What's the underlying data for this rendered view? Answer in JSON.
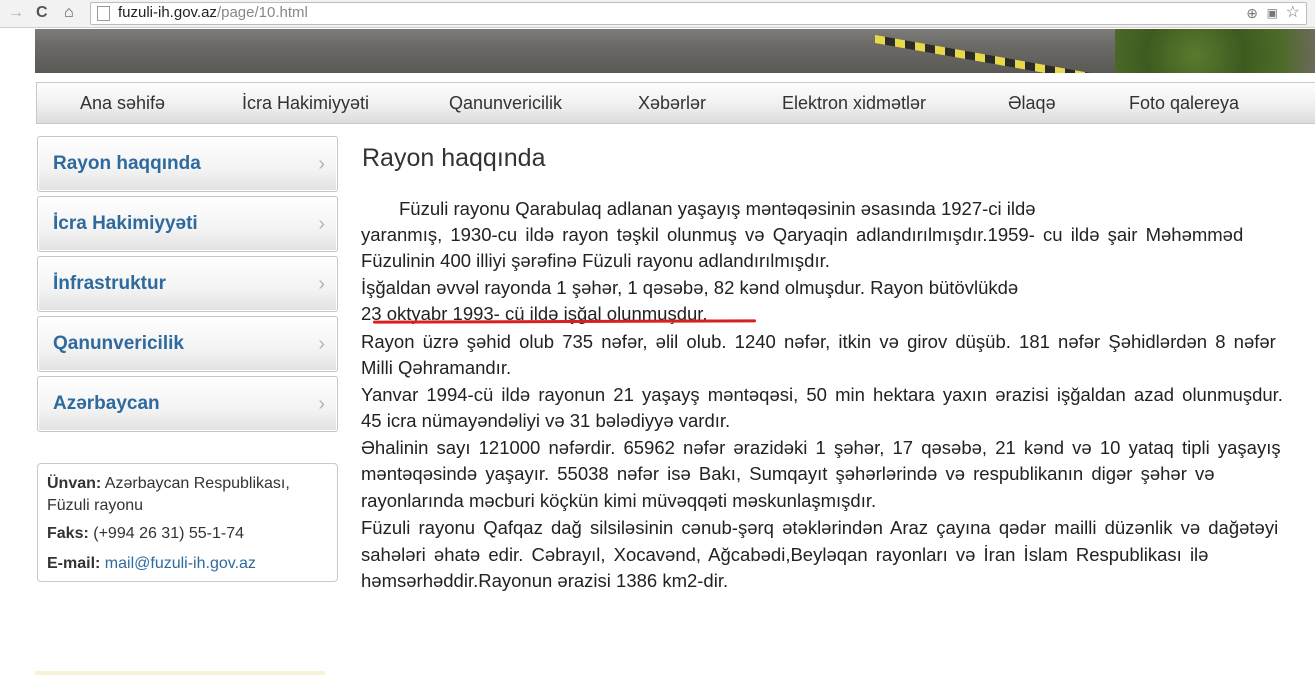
{
  "browser": {
    "url_host": "fuzuli-ih.gov.az",
    "url_path": "/page/10.html"
  },
  "menu": {
    "items": [
      "Ana səhifə",
      "İcra Hakimiyyəti",
      "Qanunvericilik",
      "Xəbərlər",
      "Elektron xidmətlər",
      "Əlaqə",
      "Foto qalereya"
    ]
  },
  "sidebar": {
    "items": [
      {
        "label": "Rayon haqqında"
      },
      {
        "label": "İcra Hakimiyyəti"
      },
      {
        "label": "İnfrastruktur"
      },
      {
        "label": "Qanunvericilik"
      },
      {
        "label": "Azərbaycan"
      }
    ]
  },
  "contact": {
    "address_label": "Ünvan:",
    "address_line1": "Azərbaycan Respublikası,",
    "address_line2": "Füzuli rayonu",
    "fax_label": "Faks:",
    "fax_value": "(+994 26 31) 55-1-74",
    "email_label": "E-mail:",
    "email_value": "mail@fuzuli-ih.gov.az"
  },
  "content": {
    "title": "Rayon haqqında",
    "lines": [
      "Füzuli rayonu Qarabulaq adlanan yaşayış məntəqəsinin əsasında 1927-ci ildə",
      "yaranmış, 1930-cu ildə rayon təşkil olunmuş və Qaryaqin adlandırılmışdır.1959- cu ildə şair Məhəmməd",
      "Füzulinin 400 illiyi şərəfinə Füzuli rayonu adlandırılmışdır.",
      "İşğaldan əvvəl rayonda 1 şəhər, 1 qəsəbə, 82 kənd olmuşdur. Rayon bütövlükdə",
      "23 oktyabr 1993- cü ildə işğal olunmuşdur.",
      "Rayon üzrə şəhid olub 735 nəfər, əlil olub. 1240 nəfər, itkin və girov düşüb. 181 nəfər Şəhidlərdən 8 nəfər",
      "Milli Qəhramandır.",
      "Yanvar 1994-cü ildə rayonun 21 yaşayş məntəqəsi, 50 min hektara yaxın ərazisi işğaldan azad olunmuşdur.",
      "45 icra nümayəndəliyi və 31 bələdiyyə vardır.",
      "Əhalinin sayı 121000 nəfərdir. 65962 nəfər ərazidəki 1 şəhər, 17 qəsəbə, 21 kənd və 10 yataq tipli yaşayış",
      "məntəqəsində yaşayır. 55038 nəfər isə Bakı, Sumqayıt şəhərlərində və respublikanın digər şəhər və",
      "rayonlarında məcburi köçkün kimi müvəqqəti məskunlaşmışdır.",
      "Füzuli rayonu Qafqaz dağ silsiləsinin cənub-şərq ətəklərindən Araz çayına qədər mailli düzənlik və dağətəyi",
      "sahələri əhatə edir. Cəbrayıl, Xocavənd, Ağcabədi,Beyləqan rayonları və İran İslam Respublikası ilə",
      "həmsərhəddir.Rayonun ərazisi 1386 km2-dir."
    ]
  },
  "colors": {
    "link": "#2e6a9e",
    "highlight_underline": "#d92020"
  }
}
